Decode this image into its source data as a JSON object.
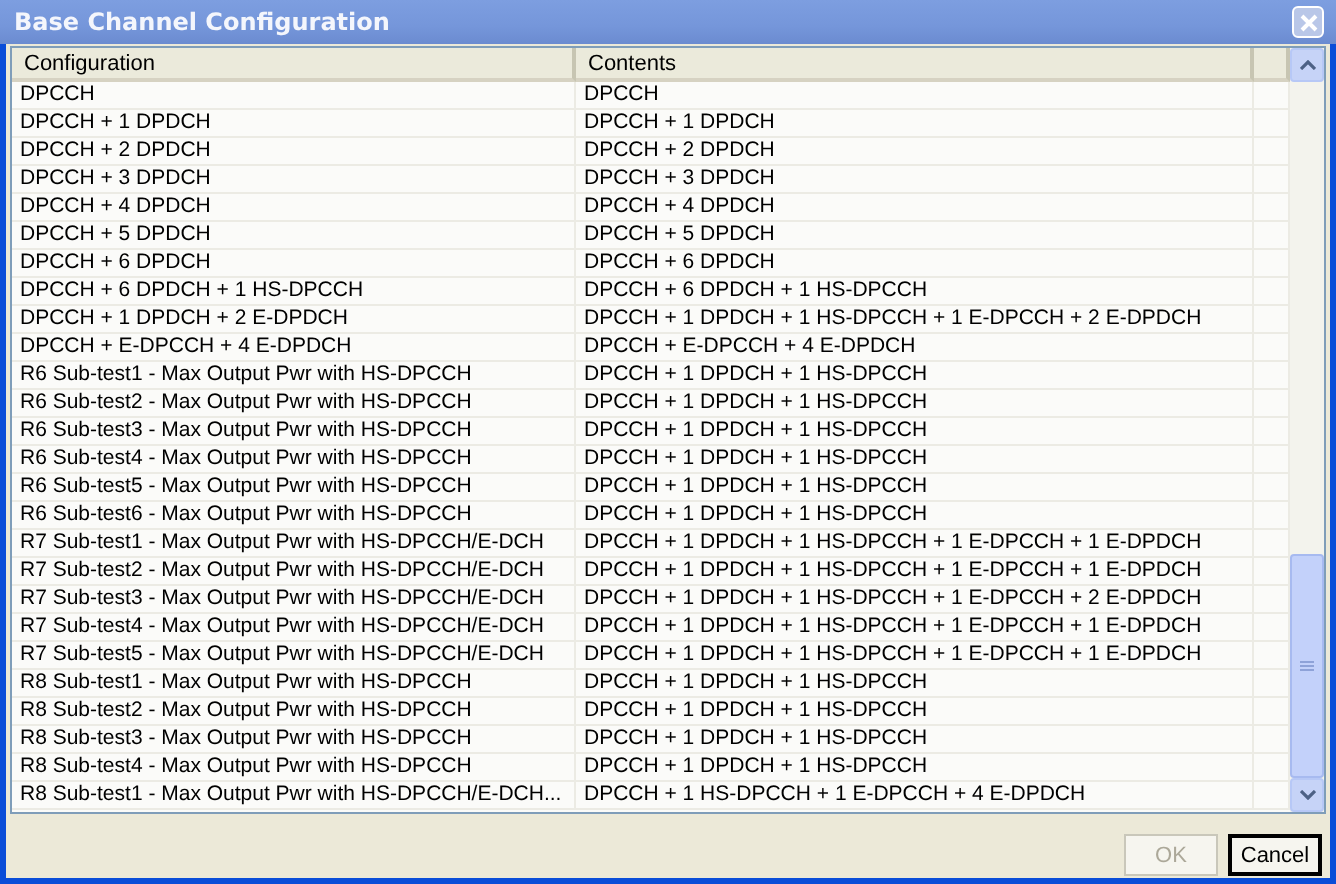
{
  "window": {
    "title": "Base Channel Configuration"
  },
  "table": {
    "columns": [
      "Configuration",
      "Contents"
    ],
    "rows": [
      {
        "configuration": "DPCCH",
        "contents": "DPCCH"
      },
      {
        "configuration": "DPCCH + 1 DPDCH",
        "contents": "DPCCH + 1 DPDCH"
      },
      {
        "configuration": "DPCCH + 2 DPDCH",
        "contents": "DPCCH + 2 DPDCH"
      },
      {
        "configuration": "DPCCH + 3 DPDCH",
        "contents": "DPCCH + 3 DPDCH"
      },
      {
        "configuration": "DPCCH + 4 DPDCH",
        "contents": "DPCCH + 4 DPDCH"
      },
      {
        "configuration": "DPCCH + 5 DPDCH",
        "contents": "DPCCH + 5 DPDCH"
      },
      {
        "configuration": "DPCCH + 6 DPDCH",
        "contents": "DPCCH + 6 DPDCH"
      },
      {
        "configuration": "DPCCH + 6 DPDCH + 1 HS-DPCCH",
        "contents": "DPCCH + 6 DPDCH + 1 HS-DPCCH"
      },
      {
        "configuration": "DPCCH + 1 DPDCH + 2 E-DPDCH",
        "contents": "DPCCH + 1 DPDCH + 1 HS-DPCCH + 1 E-DPCCH + 2 E-DPDCH"
      },
      {
        "configuration": "DPCCH + E-DPCCH + 4 E-DPDCH",
        "contents": "DPCCH + E-DPCCH + 4 E-DPDCH"
      },
      {
        "configuration": "R6 Sub-test1 - Max Output Pwr with HS-DPCCH",
        "contents": "DPCCH + 1 DPDCH + 1 HS-DPCCH"
      },
      {
        "configuration": "R6 Sub-test2 - Max Output Pwr with HS-DPCCH",
        "contents": "DPCCH + 1 DPDCH + 1 HS-DPCCH"
      },
      {
        "configuration": "R6 Sub-test3 - Max Output Pwr with HS-DPCCH",
        "contents": "DPCCH + 1 DPDCH + 1 HS-DPCCH"
      },
      {
        "configuration": "R6 Sub-test4 - Max Output Pwr with HS-DPCCH",
        "contents": "DPCCH + 1 DPDCH + 1 HS-DPCCH"
      },
      {
        "configuration": "R6 Sub-test5 - Max Output Pwr with HS-DPCCH",
        "contents": "DPCCH + 1 DPDCH + 1 HS-DPCCH"
      },
      {
        "configuration": "R6 Sub-test6 - Max Output Pwr with HS-DPCCH",
        "contents": "DPCCH + 1 DPDCH + 1 HS-DPCCH"
      },
      {
        "configuration": "R7 Sub-test1 - Max Output Pwr with HS-DPCCH/E-DCH",
        "contents": "DPCCH + 1 DPDCH + 1 HS-DPCCH + 1 E-DPCCH + 1 E-DPDCH"
      },
      {
        "configuration": "R7 Sub-test2 - Max Output Pwr with HS-DPCCH/E-DCH",
        "contents": "DPCCH + 1 DPDCH + 1 HS-DPCCH + 1 E-DPCCH + 1 E-DPDCH"
      },
      {
        "configuration": "R7 Sub-test3 - Max Output Pwr with HS-DPCCH/E-DCH",
        "contents": "DPCCH + 1 DPDCH + 1 HS-DPCCH + 1 E-DPCCH + 2 E-DPDCH"
      },
      {
        "configuration": "R7 Sub-test4 - Max Output Pwr with HS-DPCCH/E-DCH",
        "contents": "DPCCH + 1 DPDCH + 1 HS-DPCCH + 1 E-DPCCH + 1 E-DPDCH"
      },
      {
        "configuration": "R7 Sub-test5 - Max Output Pwr with HS-DPCCH/E-DCH",
        "contents": "DPCCH + 1 DPDCH + 1 HS-DPCCH + 1 E-DPCCH + 1 E-DPDCH"
      },
      {
        "configuration": "R8 Sub-test1 - Max Output Pwr with HS-DPCCH",
        "contents": "DPCCH + 1 DPDCH + 1 HS-DPCCH"
      },
      {
        "configuration": "R8 Sub-test2 - Max Output Pwr with HS-DPCCH",
        "contents": "DPCCH + 1 DPDCH + 1 HS-DPCCH"
      },
      {
        "configuration": "R8 Sub-test3 - Max Output Pwr with HS-DPCCH",
        "contents": "DPCCH + 1 DPDCH + 1 HS-DPCCH"
      },
      {
        "configuration": "R8 Sub-test4 - Max Output Pwr with HS-DPCCH",
        "contents": "DPCCH + 1 DPDCH + 1 HS-DPCCH"
      },
      {
        "configuration": "R8 Sub-test1 - Max Output Pwr with HS-DPCCH/E-DCH...",
        "contents": "DPCCH + 1 HS-DPCCH + 1 E-DPCCH + 4 E-DPDCH"
      }
    ]
  },
  "buttons": [
    {
      "label": "OK",
      "disabled": true
    },
    {
      "label": "Cancel",
      "disabled": false
    }
  ]
}
